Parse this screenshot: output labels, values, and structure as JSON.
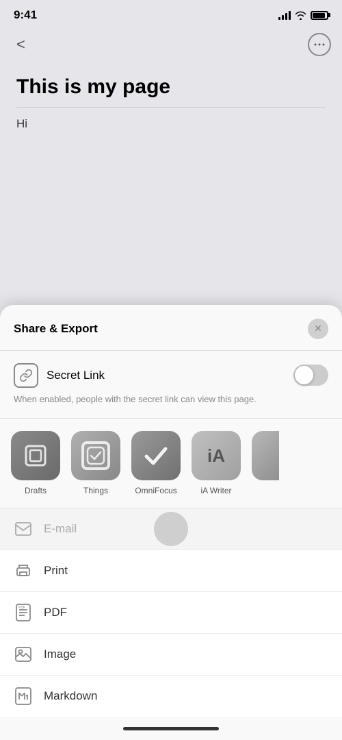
{
  "statusBar": {
    "time": "9:41",
    "battery": "full"
  },
  "topNav": {
    "backLabel": "<",
    "moreLabel": "···"
  },
  "page": {
    "title": "This is my page",
    "body": "Hi"
  },
  "shareSheet": {
    "title": "Share & Export",
    "closeLabel": "✕",
    "secretLink": {
      "label": "Secret Link",
      "description": "When enabled, people with the secret link can view this page."
    },
    "apps": [
      {
        "name": "Drafts",
        "type": "drafts"
      },
      {
        "name": "Things",
        "type": "things"
      },
      {
        "name": "OmniFocus",
        "type": "omnifocus"
      },
      {
        "name": "iA Writer",
        "type": "ia-writer"
      },
      {
        "name": "…",
        "type": "partial"
      }
    ],
    "options": [
      {
        "name": "email",
        "label": "E-mail",
        "icon": "email"
      },
      {
        "name": "print",
        "label": "Print",
        "icon": "print"
      },
      {
        "name": "pdf",
        "label": "PDF",
        "icon": "pdf"
      },
      {
        "name": "image",
        "label": "Image",
        "icon": "image"
      },
      {
        "name": "markdown",
        "label": "Markdown",
        "icon": "markdown"
      }
    ]
  }
}
